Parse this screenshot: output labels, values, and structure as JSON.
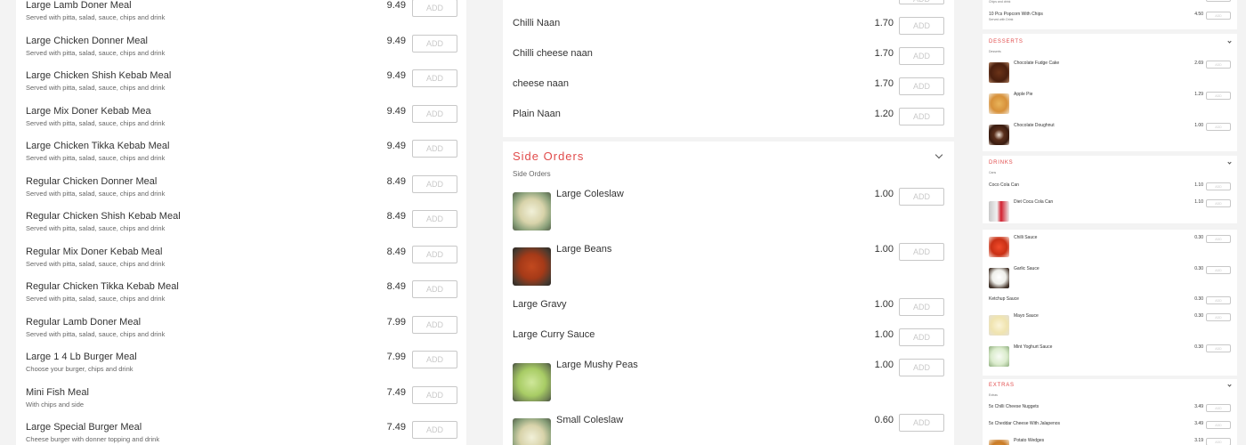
{
  "add_label": "ADD",
  "accent_color": "#e14b4b",
  "panel1": {
    "items": [
      {
        "name": "Large Lamb Doner Meal",
        "desc": "Served with pitta, salad, sauce, chips and drink",
        "price": "9.49"
      },
      {
        "name": "Large Chicken Donner Meal",
        "desc": "Served with pitta, salad, sauce, chips and drink",
        "price": "9.49"
      },
      {
        "name": "Large Chicken Shish Kebab Meal",
        "desc": "Served with pitta, salad, sauce, chips and drink",
        "price": "9.49"
      },
      {
        "name": "Large Mix Doner Kebab Mea",
        "desc": "Served with pitta, salad, sauce, chips and drink",
        "price": "9.49"
      },
      {
        "name": "Large Chicken Tikka Kebab Meal",
        "desc": "Served with pitta, salad, sauce, chips and drink",
        "price": "9.49"
      },
      {
        "name": "Regular Chicken Donner Meal",
        "desc": "Served with pitta, salad, sauce, chips and drink",
        "price": "8.49"
      },
      {
        "name": "Regular Chicken Shish Kebab Meal",
        "desc": "Served with pitta, salad, sauce, chips and drink",
        "price": "8.49"
      },
      {
        "name": "Regular Mix Doner Kebab Meal",
        "desc": "Served with pitta, salad, sauce, chips and drink",
        "price": "8.49"
      },
      {
        "name": "Regular Chicken Tikka Kebab Meal",
        "desc": "Served with pitta, salad, sauce, chips and drink",
        "price": "8.49"
      },
      {
        "name": "Regular Lamb Doner Meal",
        "desc": "Served with pitta, salad, sauce, chips and drink",
        "price": "7.99"
      },
      {
        "name": "Large 1 4 Lb Burger Meal",
        "desc": "Choose your burger, chips and drink",
        "price": "7.99"
      },
      {
        "name": "Mini Fish Meal",
        "desc": "With chips and side",
        "price": "7.49"
      },
      {
        "name": "Large Special Burger Meal",
        "desc": "Cheese burger with donner topping and drink",
        "price": "7.49"
      }
    ]
  },
  "panel2": {
    "naan_items": [
      {
        "name": "Chilli Naan",
        "price": "1.70"
      },
      {
        "name": "Chilli cheese naan",
        "price": "1.70"
      },
      {
        "name": "cheese naan",
        "price": "1.70"
      },
      {
        "name": "Plain Naan",
        "price": "1.20"
      }
    ],
    "side_orders": {
      "title": "Side Orders",
      "subtitle": "Side Orders",
      "items": [
        {
          "name": "Large Coleslaw",
          "price": "1.00",
          "image": "coleslaw"
        },
        {
          "name": "Large Beans",
          "price": "1.00",
          "image": "beans"
        },
        {
          "name": "Large Gravy",
          "price": "1.00"
        },
        {
          "name": "Large Curry Sauce",
          "price": "1.00"
        },
        {
          "name": "Large Mushy Peas",
          "price": "1.00",
          "image": "peas"
        },
        {
          "name": "Small Coleslaw",
          "price": "0.60",
          "image": "coleslaw"
        }
      ]
    }
  },
  "panel3": {
    "top_item_partial": "Chips and drink",
    "top_item": {
      "name": "10 Pcs Popcorn With Chips",
      "desc": "Served with Drink",
      "price": "4.50"
    },
    "desserts": {
      "title": "DESSERTS",
      "subtitle": "Desserts",
      "items": [
        {
          "name": "Chocolate Fudge Cake",
          "price": "2.69",
          "image": "cake"
        },
        {
          "name": "Apple Pie",
          "price": "1.29",
          "image": "pie"
        },
        {
          "name": "Chocolate Doughnut",
          "price": "1.00",
          "image": "doughnut"
        }
      ]
    },
    "drinks": {
      "title": "DRINKS",
      "subtitle": "Cans",
      "items": [
        {
          "name": "Coco Cola Can",
          "price": "1.10"
        },
        {
          "name": "Diet Coca Cola Can",
          "price": "1.10",
          "image": "can"
        }
      ]
    },
    "sauces": {
      "items": [
        {
          "name": "Chilli Sauce",
          "price": "0.30",
          "image": "chilli"
        },
        {
          "name": "Garlic Sauce",
          "price": "0.30",
          "image": "garlic"
        },
        {
          "name": "Ketchup Sauce",
          "price": "0.30"
        },
        {
          "name": "Mayo Sauce",
          "price": "0.30",
          "image": "mayo"
        },
        {
          "name": "Mint Yoghurt Sauce",
          "price": "0.30",
          "image": "mint"
        }
      ]
    },
    "extras": {
      "title": "EXTRAS",
      "subtitle": "Extras",
      "items": [
        {
          "name": "5x Chilli Cheese Nuggets",
          "price": "3.49"
        },
        {
          "name": "5x Cheddar Cheese With Jalapenos",
          "price": "3.49"
        },
        {
          "name": "Potato Wedges",
          "price": "3.19",
          "image": "wedges"
        }
      ]
    }
  }
}
